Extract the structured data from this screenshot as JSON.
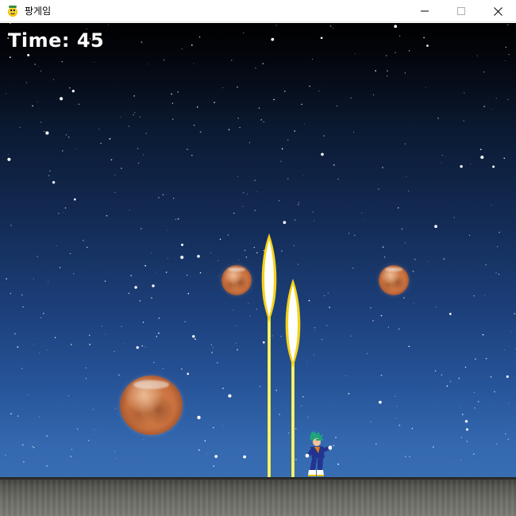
{
  "window": {
    "title": "팡게임",
    "icon": "pygame-snake-icon",
    "controls": [
      "minimize-icon",
      "maximize-icon",
      "close-icon"
    ]
  },
  "hud": {
    "time_text": "Time: 45"
  },
  "scene": {
    "background_colors": [
      "#000000",
      "#132b55",
      "#3d73b6"
    ],
    "ground_color": "#6e6e68",
    "beam_color": "#f5e72a",
    "beam_core_color": "#ffffff",
    "balls": [
      {
        "kind": "planet",
        "size": "small"
      },
      {
        "kind": "planet",
        "size": "small"
      },
      {
        "kind": "planet",
        "size": "large"
      }
    ],
    "weapons": 2,
    "player": "character-sprite"
  }
}
